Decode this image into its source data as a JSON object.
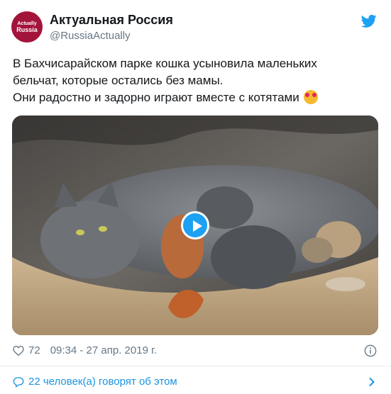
{
  "account": {
    "avatar_line1": "Actually",
    "avatar_line2": "Russia",
    "name": "Актуальная Россия",
    "handle": "@RussiaActually"
  },
  "tweet": {
    "line1": "В Бахчисарайском парке кошка усыновила маленьких",
    "line2": "бельчат, которые остались без мамы.",
    "line3": "Они радостно и задорно играют вместе с котятами",
    "emoji": "smiling-face-with-hearts"
  },
  "media": {
    "type": "video",
    "description_icon": "play-icon"
  },
  "meta": {
    "likes": "72",
    "timestamp": "09:34 - 27 апр. 2019 г."
  },
  "footer": {
    "replies_text": "22 человек(а) говорят об этом"
  },
  "colors": {
    "accent": "#1da1f2",
    "link": "#1b95e0",
    "secondary_text": "#657786",
    "avatar_bg": "#a3143a"
  }
}
